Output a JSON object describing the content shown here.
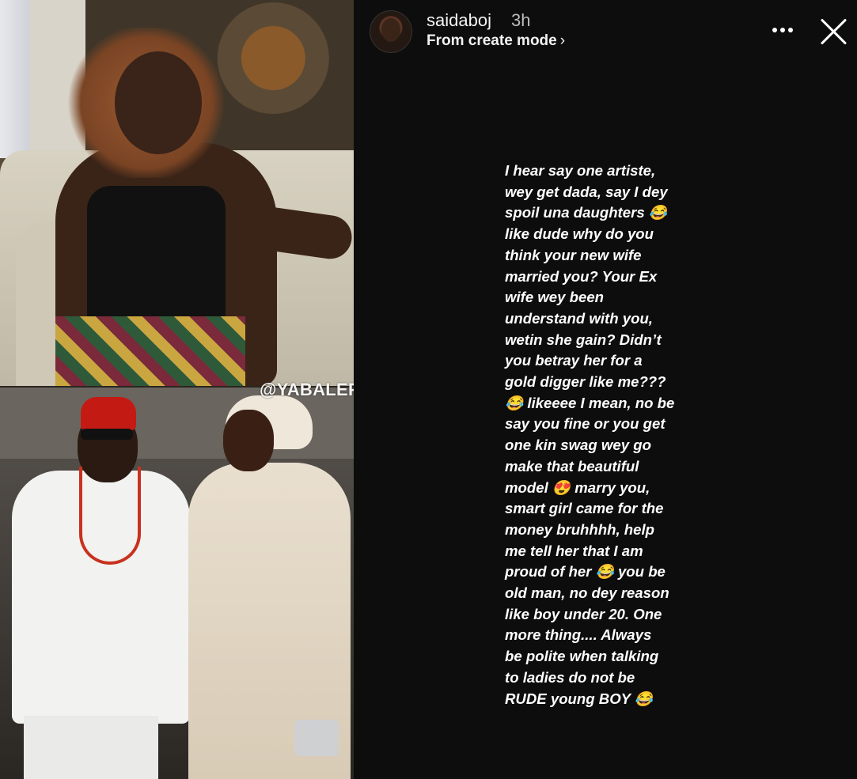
{
  "watermark": "@YABALEFTONLINE",
  "story": {
    "username": "saidaboj",
    "time_ago": "3h",
    "source": "From create mode",
    "source_chevron": "›",
    "lines": [
      "I hear say one artiste,",
      "wey get dada, say I dey",
      "spoil una daughters 😂",
      "like dude why do you",
      "think your new wife",
      "married you? Your Ex",
      "wife wey been",
      "understand with you,",
      "wetin she gain? Didn’t",
      "you betray her for a",
      "gold digger like me???",
      "😂 likeeee I mean, no be",
      "say you fine or you get",
      "one kin swag wey go",
      "make that beautiful",
      "model 😍 marry you,",
      "smart girl came for the",
      "money bruhhhh, help",
      "me tell her that I am",
      "proud of her 😂  you be",
      "old man, no dey reason",
      "like boy  under 20. One",
      "more thing.... Always",
      "be polite when talking",
      "to ladies do not be",
      "RUDE young BOY 😂"
    ]
  }
}
